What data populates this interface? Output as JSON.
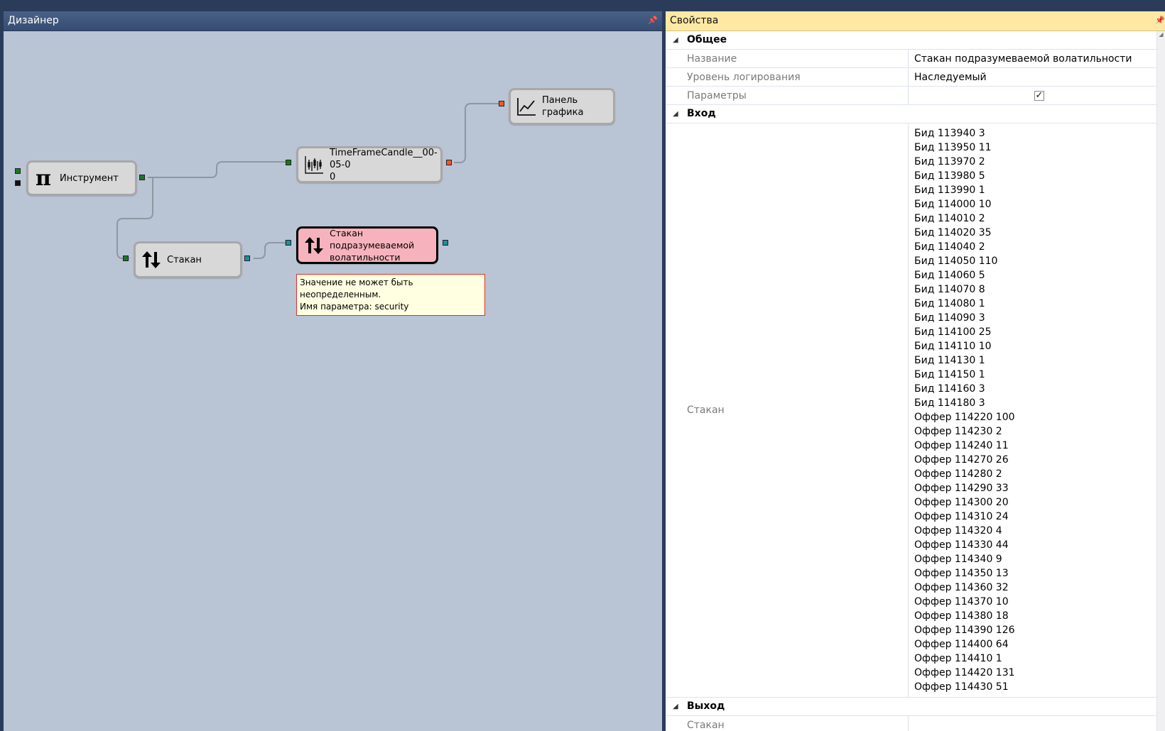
{
  "designer": {
    "title": "Дизайнер",
    "nodes": {
      "instrument": {
        "label": "Инструмент",
        "icon": "pi-icon"
      },
      "candle": {
        "label": "TimeFrameCandle__00-05-0\n0",
        "icon": "candlestick-chart-icon"
      },
      "chart": {
        "label": "Панель графика",
        "icon": "line-chart-icon"
      },
      "depth": {
        "label": "Стакан",
        "icon": "up-down-arrows-icon"
      },
      "ivdepth": {
        "label": "Стакан подразумеваемой\nволатильности",
        "icon": "up-down-arrows-icon"
      }
    },
    "tooltip": {
      "line1": "Значение не может быть неопределенным.",
      "line2": "Имя параметра: security"
    },
    "colors": {
      "port_green": "#177a1c",
      "port_teal": "#1c8f9c",
      "port_orange": "#f05a22",
      "error_fill": "#f7b3bd"
    }
  },
  "properties": {
    "title": "Свойства",
    "general": {
      "category": "Общее",
      "name_label": "Название",
      "name_value": "Стакан подразумеваемой волатильности",
      "log_label": "Уровень логирования",
      "log_value": "Наследуемый",
      "params_label": "Параметры",
      "params_checked": true
    },
    "input": {
      "category": "Вход",
      "depth_label": "Стакан",
      "depth_lines": [
        "Бид 113940 3",
        "Бид 113950 11",
        "Бид 113970 2",
        "Бид 113980 5",
        "Бид 113990 1",
        "Бид 114000 10",
        "Бид 114010 2",
        "Бид 114020 35",
        "Бид 114040 2",
        "Бид 114050 110",
        "Бид 114060 5",
        "Бид 114070 8",
        "Бид 114080 1",
        "Бид 114090 3",
        "Бид 114100 25",
        "Бид 114110 10",
        "Бид 114130 1",
        "Бид 114150 1",
        "Бид 114160 3",
        "Бид 114180 3",
        "Оффер 114220 100",
        "Оффер 114230 2",
        "Оффер 114240 11",
        "Оффер 114270 26",
        "Оффер 114280 2",
        "Оффер 114290 33",
        "Оффер 114300 20",
        "Оффер 114310 24",
        "Оффер 114320 4",
        "Оффер 114330 44",
        "Оффер 114340 9",
        "Оффер 114350 13",
        "Оффер 114360 32",
        "Оффер 114370 10",
        "Оффер 114380 18",
        "Оффер 114390 126",
        "Оффер 114400 64",
        "Оффер 114410 1",
        "Оффер 114420 131",
        "Оффер 114430 51"
      ]
    },
    "output": {
      "category": "Выход",
      "depth_label": "Стакан",
      "depth_value": ""
    }
  }
}
